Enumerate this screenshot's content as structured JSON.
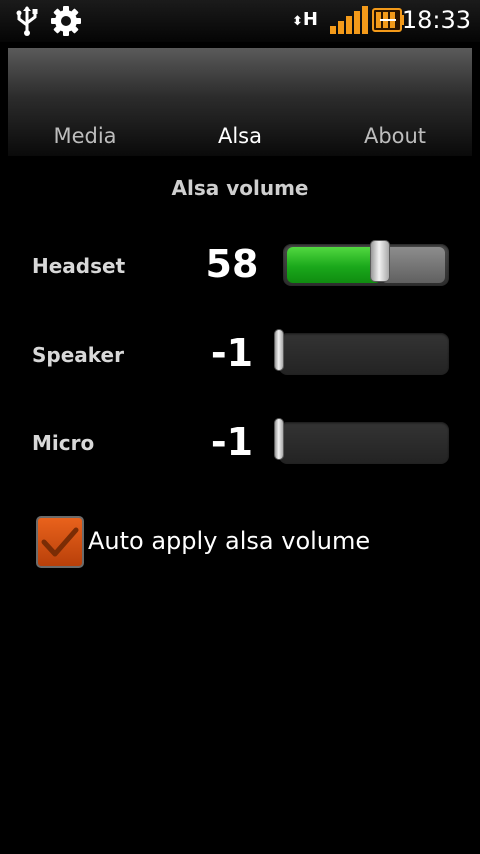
{
  "status_bar": {
    "icons": [
      "usb-icon",
      "settings-gear-icon",
      "data-arrows-icon",
      "signal-icon",
      "battery-icon"
    ],
    "network_type": "H",
    "time": "18:33"
  },
  "tabs": [
    {
      "label": "Media",
      "selected": false
    },
    {
      "label": "Alsa",
      "selected": true
    },
    {
      "label": "About",
      "selected": false
    }
  ],
  "section_title": "Alsa volume",
  "controls": [
    {
      "label": "Headset",
      "value": "58",
      "level": 0.58
    },
    {
      "label": "Speaker",
      "value": "-1",
      "level": 0
    },
    {
      "label": "Micro",
      "value": "-1",
      "level": 0
    }
  ],
  "auto_apply": {
    "label": "Auto apply alsa volume",
    "checked": true
  },
  "colors": {
    "accent_green": "#1aa81b",
    "checkbox_orange": "#e9621c",
    "background": "#000000"
  }
}
